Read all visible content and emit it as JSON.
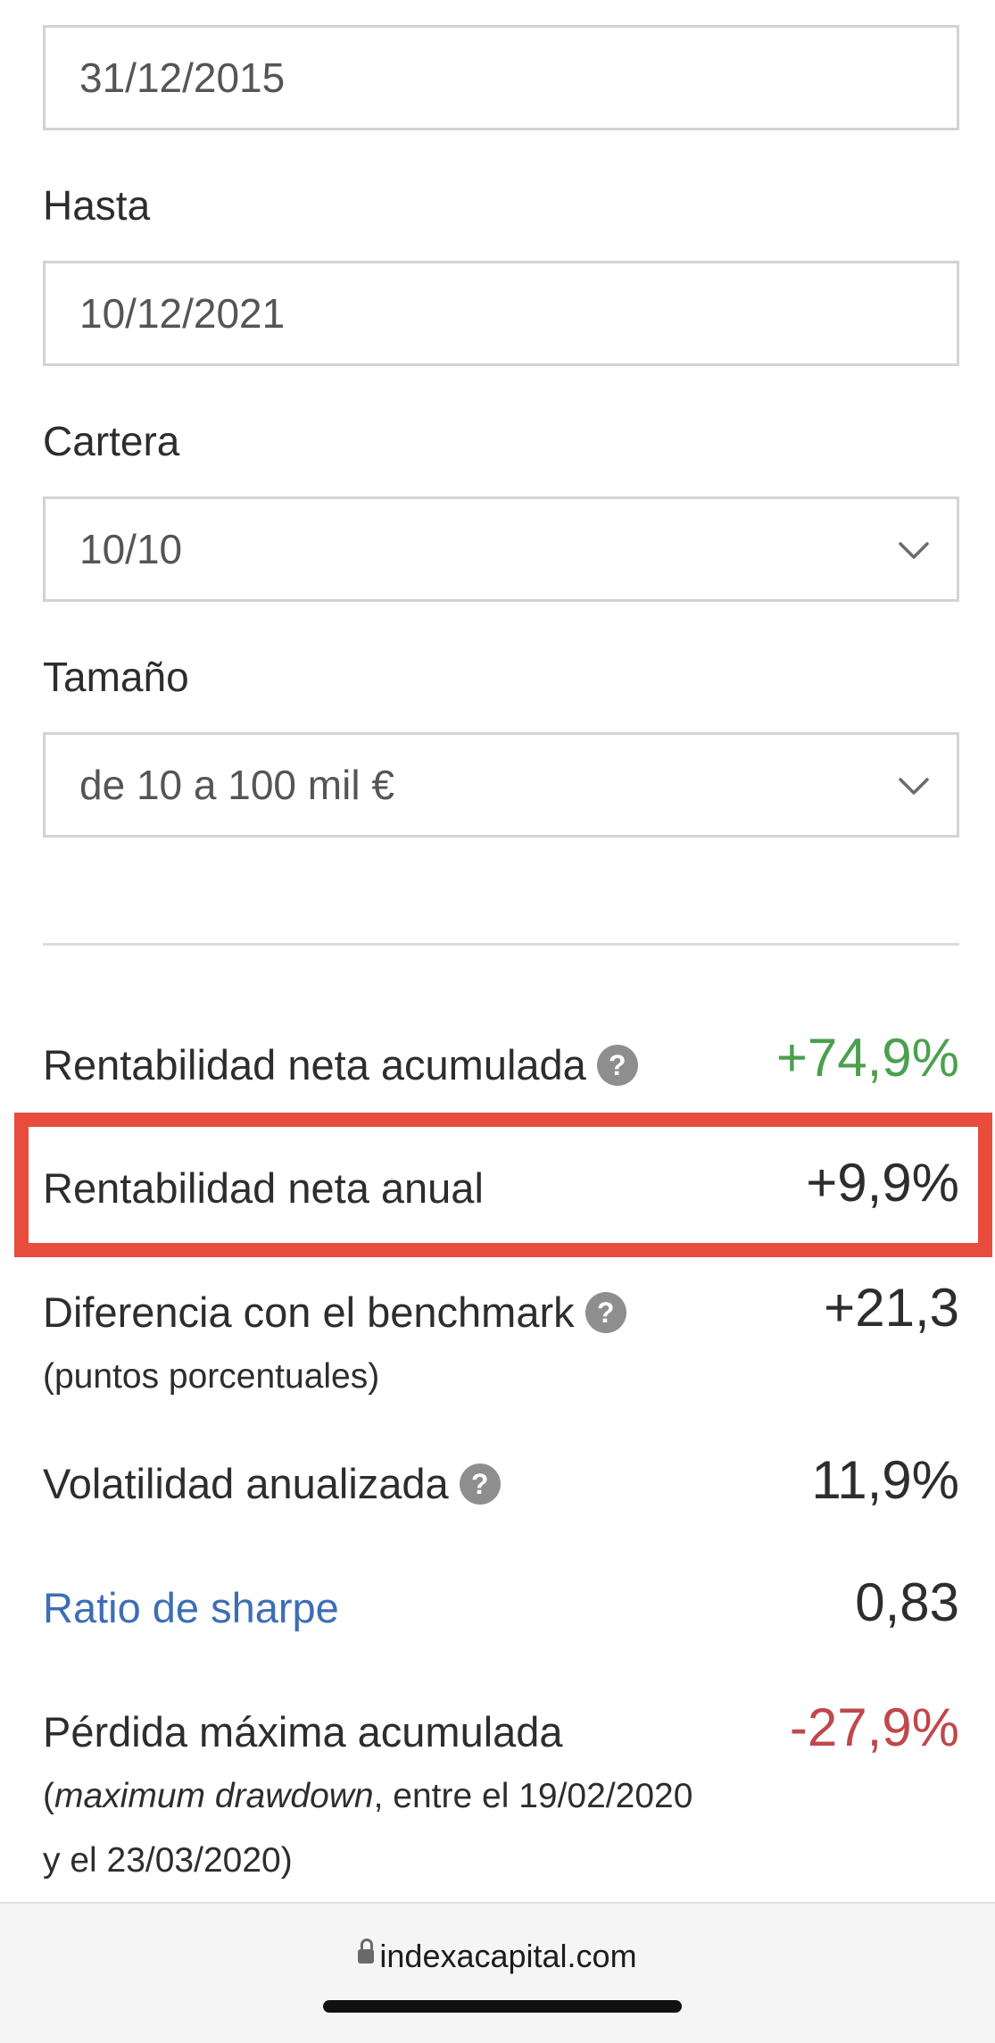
{
  "form": {
    "desde_value": "31/12/2015",
    "hasta_label": "Hasta",
    "hasta_value": "10/12/2021",
    "cartera_label": "Cartera",
    "cartera_value": "10/10",
    "tamano_label": "Tamaño",
    "tamano_value": "de 10 a 100 mil €"
  },
  "metrics": {
    "rent_acumulada": {
      "label": "Rentabilidad neta acumulada",
      "value": "+74,9%",
      "color": "#4ba04e"
    },
    "rent_anual": {
      "label": "Rentabilidad neta anual",
      "value": "+9,9%"
    },
    "diferencia": {
      "label": "Diferencia con el benchmark",
      "sub": "(puntos porcentuales)",
      "value": "+21,3"
    },
    "volatilidad": {
      "label": "Volatilidad anualizada",
      "value": "11,9%"
    },
    "sharpe": {
      "label": "Ratio de sharpe",
      "value": "0,83",
      "color": "#3d6eb4"
    },
    "perdida": {
      "label": "Pérdida máxima acumulada",
      "sub_open": "(",
      "sub_italic": "maximum drawdown",
      "sub_rest": ", entre el 19/02/2020",
      "sub_line2": "y el 23/03/2020)",
      "value": "-27,9%",
      "color": "#c0474a"
    }
  },
  "help_icon_glyph": "?",
  "highlight_color": "#e84c3d",
  "browser": {
    "url": "indexacapital.com"
  }
}
